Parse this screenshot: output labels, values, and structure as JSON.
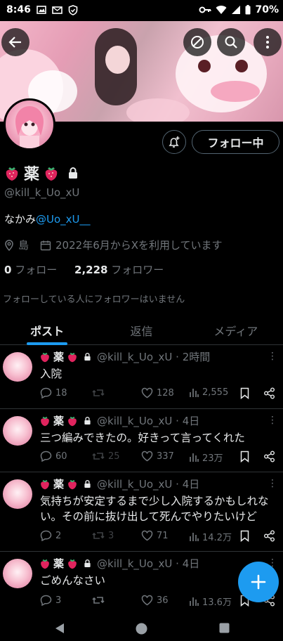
{
  "status": {
    "time": "8:46",
    "battery": "70%"
  },
  "profile": {
    "name_text": "薬",
    "handle": "@kill_k_Uo_xU",
    "bio_prefix": "なかみ",
    "bio_mention": "@Uo_xU__",
    "location": "島",
    "joined": "2022年6月からXを利用しています",
    "following_count": "0",
    "following_label": "フォロー",
    "followers_count": "2,228",
    "followers_label": "フォロワー",
    "follow_button": "フォロー中",
    "no_common_followers": "フォローしている人にフォロワーはいません"
  },
  "tabs": [
    {
      "label": "ポスト"
    },
    {
      "label": "返信"
    },
    {
      "label": "メディア"
    }
  ],
  "tweets": [
    {
      "name": "薬",
      "handle_time": "@kill_k_Uo_xU · 2時間",
      "text": "入院",
      "replies": "18",
      "retweets": "",
      "likes": "128",
      "views": "2,555"
    },
    {
      "name": "薬",
      "handle_time": "@kill_k_Uo_xU · 4日",
      "text": "三つ編みできたの。好きって言ってくれた",
      "replies": "60",
      "retweets": "25",
      "likes": "337",
      "views": "23万"
    },
    {
      "name": "薬",
      "handle_time": "@kill_k_Uo_xU · 4日",
      "text": "気持ちが安定するまで少し入院するかもしれない。その前に抜け出して死んでやりたいけど",
      "replies": "2",
      "retweets": "3",
      "likes": "71",
      "views": "14.2万"
    },
    {
      "name": "薬",
      "handle_time": "@kill_k_Uo_xU · 4日",
      "text": "ごめんなさい",
      "replies": "3",
      "retweets": "",
      "likes": "36",
      "views": "13.6万"
    }
  ],
  "colors": {
    "accent": "#1d9bf0",
    "muted": "#71767b",
    "text": "#e7e9ea",
    "border": "#2f3336",
    "strawberry": "#e0245e"
  },
  "icons": {
    "back": "arrow-left-icon",
    "mute": "circle-slash-icon",
    "search": "search-icon",
    "more": "more-vertical-icon",
    "bell": "bell-plus-icon",
    "lock": "lock-icon",
    "location": "location-pin-icon",
    "calendar": "calendar-icon",
    "compose": "plus-icon"
  }
}
